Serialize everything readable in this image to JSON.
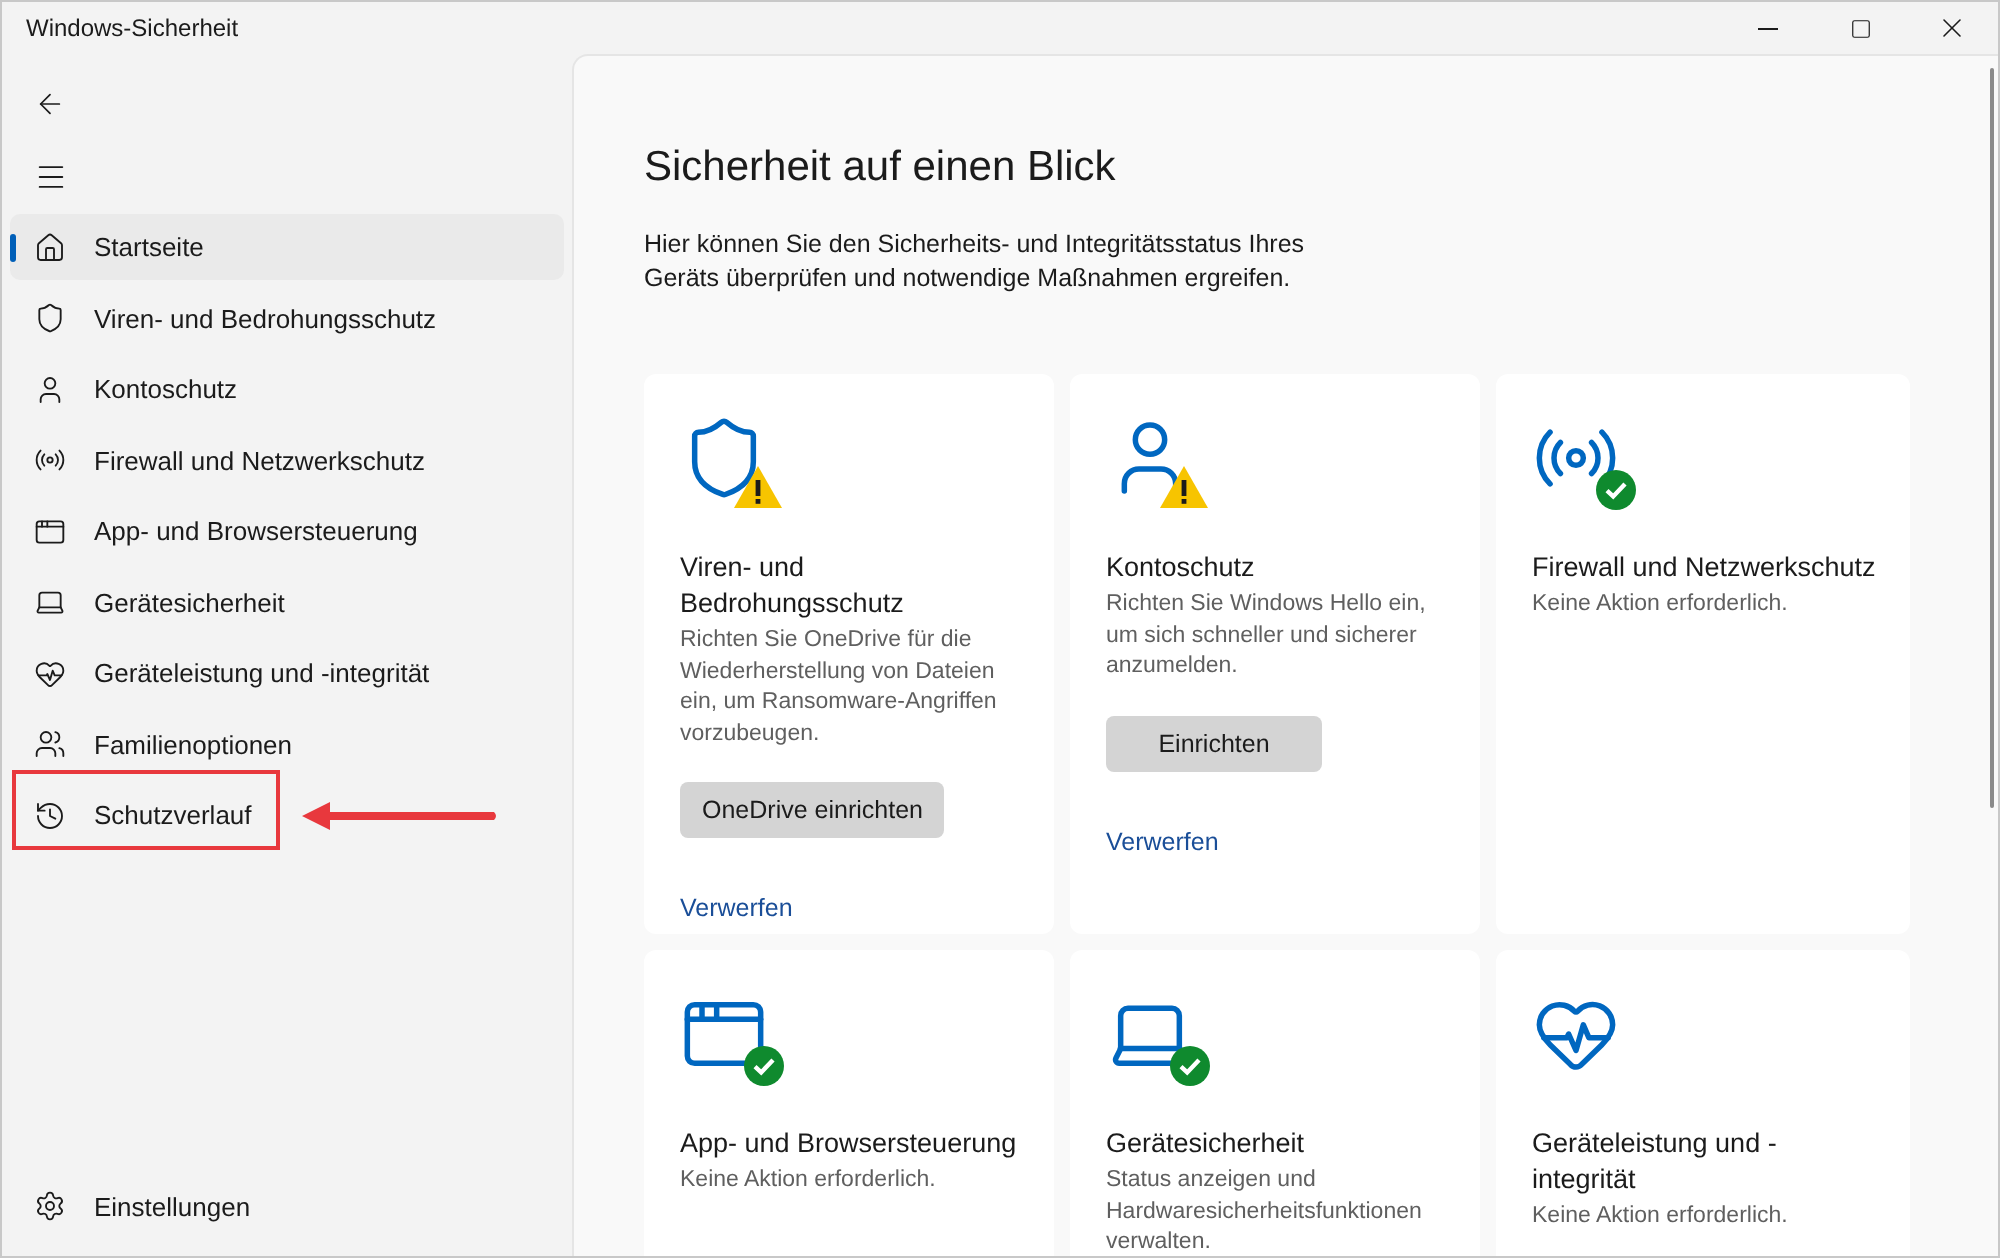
{
  "window": {
    "title": "Windows-Sicherheit"
  },
  "sidebar": {
    "items": [
      {
        "label": "Startseite",
        "selected": true,
        "annotated": false
      },
      {
        "label": "Viren- und Bedrohungsschutz",
        "selected": false,
        "annotated": false
      },
      {
        "label": "Kontoschutz",
        "selected": false,
        "annotated": false
      },
      {
        "label": "Firewall und Netzwerkschutz",
        "selected": false,
        "annotated": false
      },
      {
        "label": "App- und Browsersteuerung",
        "selected": false,
        "annotated": false
      },
      {
        "label": "Gerätesicherheit",
        "selected": false,
        "annotated": false
      },
      {
        "label": "Geräteleistung und -integrität",
        "selected": false,
        "annotated": false
      },
      {
        "label": "Familienoptionen",
        "selected": false,
        "annotated": false
      },
      {
        "label": "Schutzverlauf",
        "selected": false,
        "annotated": true
      }
    ],
    "settings": {
      "label": "Einstellungen"
    }
  },
  "main": {
    "title": "Sicherheit auf einen Blick",
    "subtitle": "Hier können Sie den Sicherheits- und Integritätsstatus Ihres Geräts überprüfen und notwendige Maßnahmen ergreifen.",
    "cards": [
      {
        "title": "Viren- und Bedrohungsschutz",
        "warning": true,
        "ok": false,
        "description": "Richten Sie OneDrive für die Wiederherstellung von Dateien ein, um Ransomware-Angriffen vorzubeugen.",
        "button": "OneDrive einrichten",
        "link": "Verwerfen"
      },
      {
        "title": "Kontoschutz",
        "warning": true,
        "ok": false,
        "description": "Richten Sie Windows Hello ein, um sich schneller und sicherer anzumelden.",
        "button": "Einrichten",
        "link": "Verwerfen"
      },
      {
        "title": "Firewall und Netzwerkschutz",
        "warning": false,
        "ok": true,
        "description": "Keine Aktion erforderlich."
      },
      {
        "title": "App- und Browsersteuerung",
        "warning": false,
        "ok": true,
        "description": "Keine Aktion erforderlich."
      },
      {
        "title": "Gerätesicherheit",
        "warning": false,
        "ok": true,
        "description": "Status anzeigen und Hardwaresicherheitsfunktionen verwalten."
      },
      {
        "title": "Geräteleistung und -integrität",
        "warning": false,
        "ok": false,
        "description": "Keine Aktion erforderlich."
      }
    ]
  }
}
